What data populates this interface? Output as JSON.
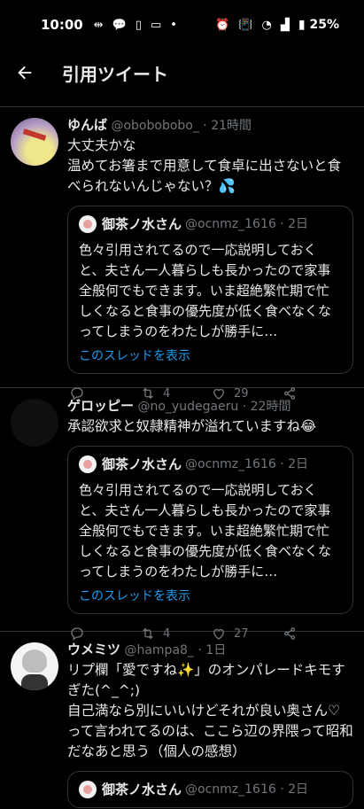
{
  "status": {
    "time": "10:00",
    "battery": "25%"
  },
  "header": {
    "title": "引用ツイート"
  },
  "tweets": [
    {
      "name": "ゆんば",
      "handle": "@obobobobo_ · 21時間",
      "text": "大丈夫かな\n温めてお箸まで用意して食卓に出さないと食べられないんじゃない？💦",
      "quote": {
        "name": "御茶ノ水さん",
        "handle": "@ocnmz_1616 · 2日",
        "text": "色々引用されてるので一応説明しておくと、夫さん一人暮らしも長かったので家事全般何でもできます。いま超絶繁忙期で忙しくなると食事の優先度が低く食べなくなってしまうのをわたしが勝手に…",
        "link": "このスレッドを表示"
      },
      "stats": {
        "retweets": "4",
        "likes": "29"
      }
    },
    {
      "name": "ゲロッピー",
      "handle": "@no_yudegaeru · 22時間",
      "text": "承認欲求と奴隷精神が溢れていますね😂",
      "quote": {
        "name": "御茶ノ水さん",
        "handle": "@ocnmz_1616 · 2日",
        "text": "色々引用されてるので一応説明しておくと、夫さん一人暮らしも長かったので家事全般何でもできます。いま超絶繁忙期で忙しくなると食事の優先度が低く食べなくなってしまうのをわたしが勝手に…",
        "link": "このスレッドを表示"
      },
      "stats": {
        "retweets": "4",
        "likes": "27"
      }
    },
    {
      "name": "ウメミツ",
      "handle": "@hampa8_ · 1日",
      "text": "リプ欄「愛ですね✨」のオンパレードキモすぎた(^_^;)\n自己満なら別にいいけどそれが良い奥さん♡って言われてるのは、ここら辺の界隈って昭和だなあと思う（個人の感想）",
      "quote": {
        "name": "御茶ノ水さん",
        "handle": "@ocnmz_1616 · 2日"
      }
    }
  ]
}
